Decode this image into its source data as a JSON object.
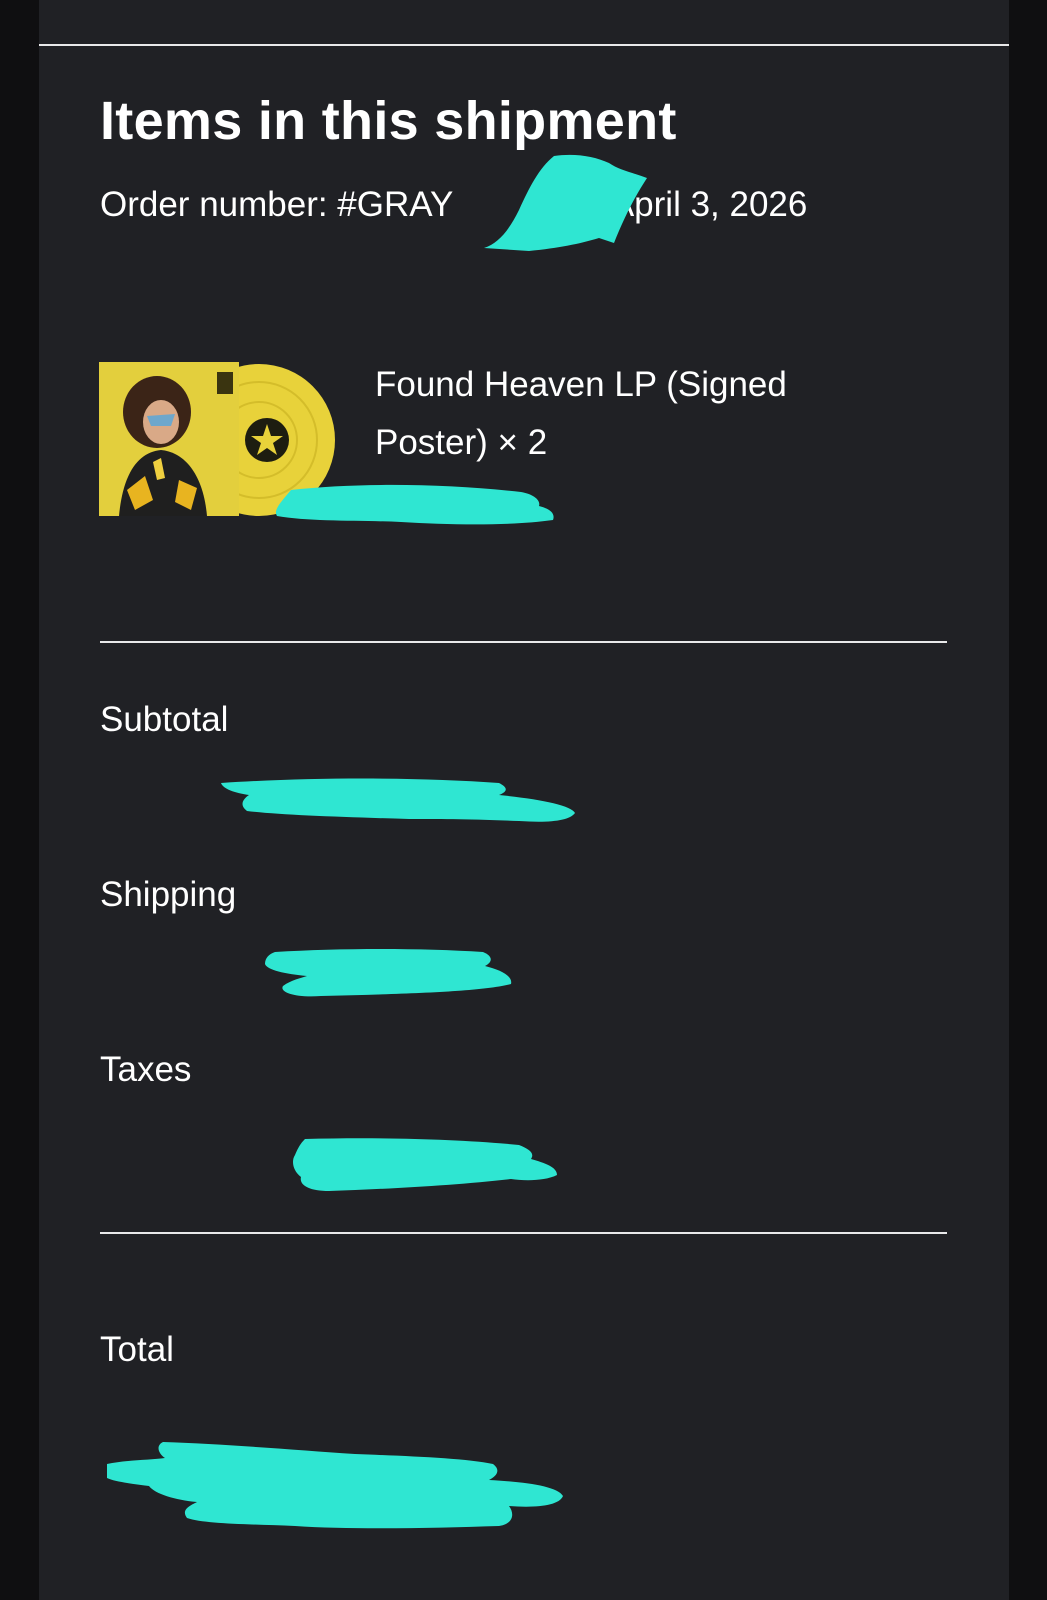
{
  "shipment": {
    "heading": "Items in this shipment",
    "order_prefix": "Order number: #GRAY",
    "order_date": " - April 3, 2026"
  },
  "item": {
    "title": "Found Heaven LP (Signed Poster) × 2",
    "image_icon": "album-cover-with-yellow-vinyl"
  },
  "summary": {
    "subtotal_label": "Subtotal",
    "shipping_label": "Shipping",
    "taxes_label": "Taxes",
    "total_label": "Total"
  },
  "colors": {
    "background": "#202125",
    "outer_background": "#0f0f11",
    "text": "#ffffff",
    "divider": "#e9e9ea",
    "redaction": "#2fe6d2",
    "vinyl_yellow": "#e8d23a"
  }
}
